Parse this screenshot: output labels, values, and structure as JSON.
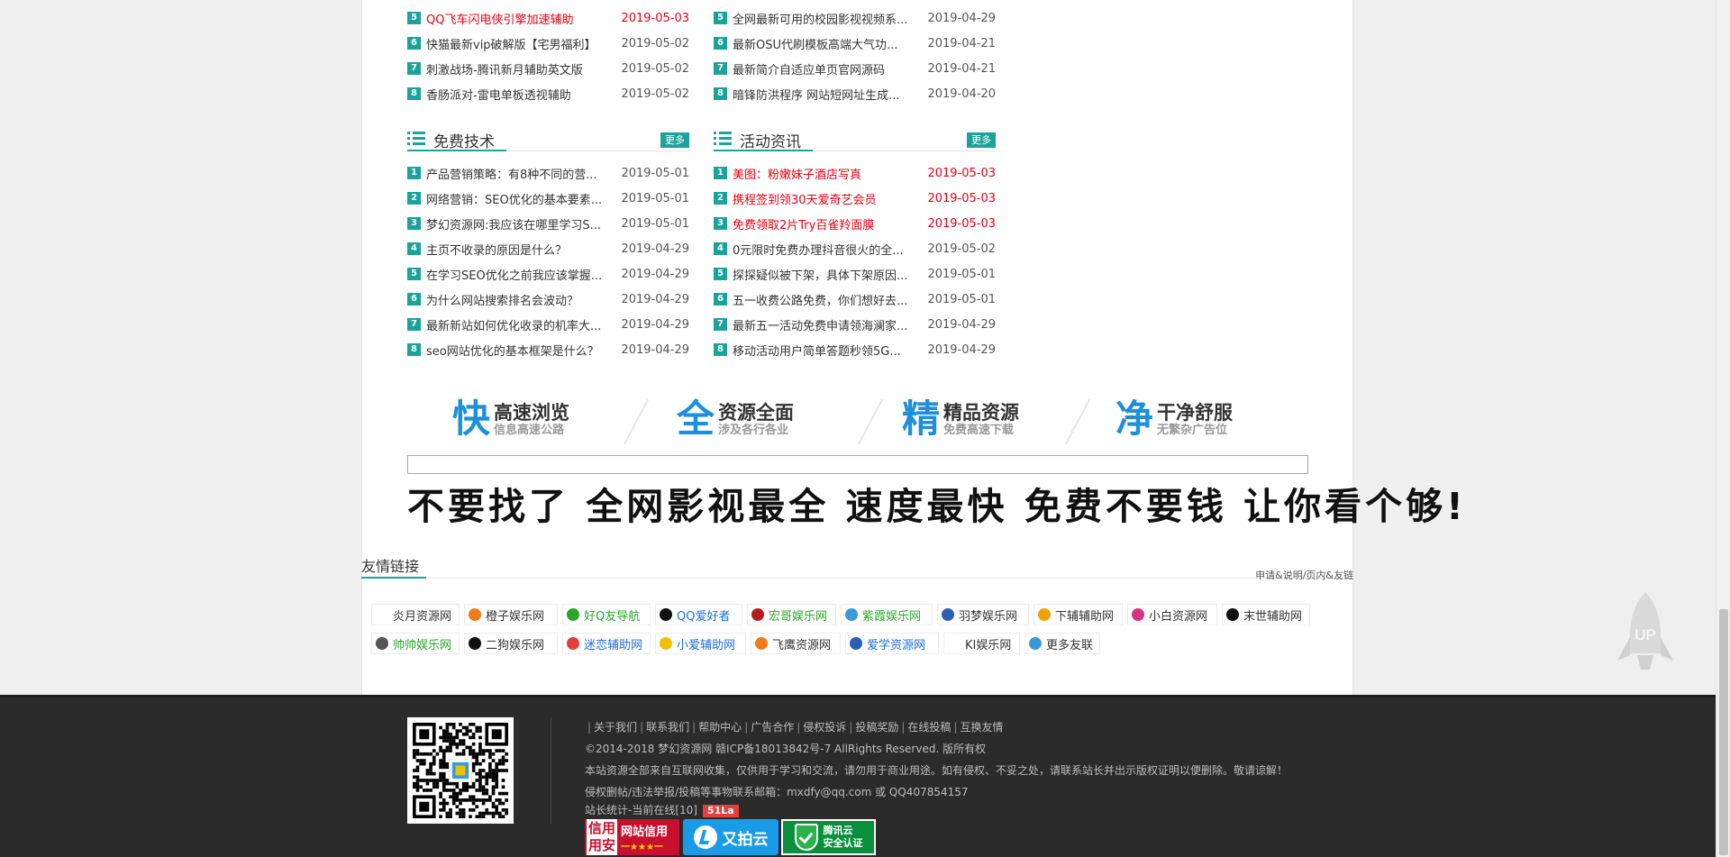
{
  "sections": {
    "top_left": {
      "items": [
        {
          "num": "5",
          "title": "QQ飞车闪电侠引擎加速辅助",
          "date": "2019-05-03",
          "hot": true
        },
        {
          "num": "6",
          "title": "快猫最新vip破解版【宅男福利】",
          "date": "2019-05-02",
          "hot": false
        },
        {
          "num": "7",
          "title": "刺激战场-腾讯新月辅助英文版",
          "date": "2019-05-02",
          "hot": false
        },
        {
          "num": "8",
          "title": "香肠派对-雷电单板透视辅助",
          "date": "2019-05-02",
          "hot": false
        }
      ]
    },
    "top_right": {
      "items": [
        {
          "num": "5",
          "title": "全网最新可用的校园影视视频系...",
          "date": "2019-04-29",
          "hot": false
        },
        {
          "num": "6",
          "title": "最新OSU代刷模板高端大气功...",
          "date": "2019-04-21",
          "hot": false
        },
        {
          "num": "7",
          "title": "最新简介自适应单页官网源码",
          "date": "2019-04-21",
          "hot": false
        },
        {
          "num": "8",
          "title": "暗锋防洪程序 网站短网址生成...",
          "date": "2019-04-20",
          "hot": false
        }
      ]
    },
    "free_tech": {
      "title": "免费技术",
      "more": "更多",
      "items": [
        {
          "num": "1",
          "title": "产品营销策略：有8种不同的营...",
          "date": "2019-05-01",
          "hot": false
        },
        {
          "num": "2",
          "title": "网络营销：SEO优化的基本要素...",
          "date": "2019-05-01",
          "hot": false
        },
        {
          "num": "3",
          "title": "梦幻资源网:我应该在哪里学习S...",
          "date": "2019-05-01",
          "hot": false
        },
        {
          "num": "4",
          "title": "主页不收录的原因是什么？",
          "date": "2019-04-29",
          "hot": false
        },
        {
          "num": "5",
          "title": "在学习SEO优化之前我应该掌握...",
          "date": "2019-04-29",
          "hot": false
        },
        {
          "num": "6",
          "title": "为什么网站搜索排名会波动？",
          "date": "2019-04-29",
          "hot": false
        },
        {
          "num": "7",
          "title": "最新新站如何优化收录的机率大...",
          "date": "2019-04-29",
          "hot": false
        },
        {
          "num": "8",
          "title": "seo网站优化的基本框架是什么？",
          "date": "2019-04-29",
          "hot": false
        }
      ]
    },
    "activities": {
      "title": "活动资讯",
      "more": "更多",
      "items": [
        {
          "num": "1",
          "title": "美图：粉嫩妹子酒店写真",
          "date": "2019-05-03",
          "hot": true
        },
        {
          "num": "2",
          "title": "携程签到领30天爱奇艺会员",
          "date": "2019-05-03",
          "hot": true
        },
        {
          "num": "3",
          "title": "免费领取2片Try百雀羚面膜",
          "date": "2019-05-03",
          "hot": true
        },
        {
          "num": "4",
          "title": "0元限时免费办理抖音很火的全...",
          "date": "2019-05-02",
          "hot": false
        },
        {
          "num": "5",
          "title": "探探疑似被下架，具体下架原因...",
          "date": "2019-05-01",
          "hot": false
        },
        {
          "num": "6",
          "title": "五一收费公路免费，你们想好去...",
          "date": "2019-05-01",
          "hot": false
        },
        {
          "num": "7",
          "title": "最新五一活动免费申请领海澜家...",
          "date": "2019-04-29",
          "hot": false
        },
        {
          "num": "8",
          "title": "移动活动用户简单答题秒领5G...",
          "date": "2019-04-29",
          "hot": false
        }
      ]
    }
  },
  "features": [
    {
      "big": "快",
      "t1": "高速浏览",
      "t2": "信息高速公路"
    },
    {
      "big": "全",
      "t1": "资源全面",
      "t2": "涉及各行各业"
    },
    {
      "big": "精",
      "t1": "精品资源",
      "t2": "免费高速下载"
    },
    {
      "big": "净",
      "t1": "干净舒服",
      "t2": "无繁杂广告位"
    }
  ],
  "banner": {
    "text": "不要找了 全网影视最全 速度最快 免费不要钱 让你看个够!"
  },
  "friend_links": {
    "title": "友情链接",
    "apply": "申请&说明/页内&友链",
    "row1": [
      {
        "name": "炎月资源网",
        "color": "#333333",
        "icon": "#ffffff"
      },
      {
        "name": "橙子娱乐网",
        "color": "#333333",
        "icon": "#f07b1a"
      },
      {
        "name": "好Q友导航",
        "color": "#2aa52a",
        "icon": "#2aa52a"
      },
      {
        "name": "QQ爱好者",
        "color": "#1e6ed8",
        "icon": "#111111"
      },
      {
        "name": "宏哥娱乐网",
        "color": "#2aa52a",
        "icon": "#b81d1d"
      },
      {
        "name": "紫霞娱乐网",
        "color": "#2aa52a",
        "icon": "#3a9ad9"
      },
      {
        "name": "羽梦娱乐网",
        "color": "#333333",
        "icon": "#2b5fb5"
      },
      {
        "name": "下辅辅助网",
        "color": "#333333",
        "icon": "#f0a000"
      },
      {
        "name": "小白资源网",
        "color": "#333333",
        "icon": "#d63384"
      },
      {
        "name": "末世辅助网",
        "color": "#333333",
        "icon": "#111111"
      }
    ],
    "row2": [
      {
        "name": "帅帅娱乐网",
        "color": "#2aa52a",
        "icon": "#555555"
      },
      {
        "name": "二狗娱乐网",
        "color": "#333333",
        "icon": "#111111"
      },
      {
        "name": "迷恋辅助网",
        "color": "#1e6ed8",
        "icon": "#e53e3e"
      },
      {
        "name": "小爱辅助网",
        "color": "#1e6ed8",
        "icon": "#f0c000"
      },
      {
        "name": "飞鹰资源网",
        "color": "#333333",
        "icon": "#f07b1a"
      },
      {
        "name": "爱学资源网",
        "color": "#1e6ed8",
        "icon": "#2b5fb5"
      },
      {
        "name": "KI娱乐网",
        "color": "#333333",
        "icon": "#ffffff"
      },
      {
        "name": "更多友联",
        "color": "#333333",
        "icon": "#3a9ad9"
      }
    ]
  },
  "footer": {
    "nav": [
      "关于我们",
      "联系我们",
      "帮助中心",
      "广告合作",
      "侵权投诉",
      "投稿奖励",
      "在线投稿",
      "互换友情"
    ],
    "copyright": "©2014-2018 梦幻资源网 赣ICP备18013842号-7 AllRights Reserved. 版所有权",
    "notice": "本站资源全部来自互联网收集，仅供用于学习和交流，请勿用于商业用途。如有侵权、不妥之处，请联系站长并出示版权证明以便删除。敬请谅解！",
    "contact": "侵权删帖/违法举报/投稿等事物联系邮箱：mxdfy@qq.com 或 QQ407854157",
    "stats": "站长统计-当前在线[10]",
    "stats_badge": "51La",
    "badge_credit_left": "信用",
    "badge_credit_left2": "用安",
    "badge_credit_title": "网站信用",
    "badge_credit_stars": "一★★★一",
    "badge_upyun": "又拍云",
    "badge_tencent": "腾讯云",
    "badge_tencent2": "安全认证"
  },
  "up_button": {
    "label": "UP"
  },
  "colors": {
    "accent": "#1aa39a",
    "hot": "#e60012",
    "feature_blue": "#1e8fd8",
    "footer_bg": "#2b2b2b"
  }
}
